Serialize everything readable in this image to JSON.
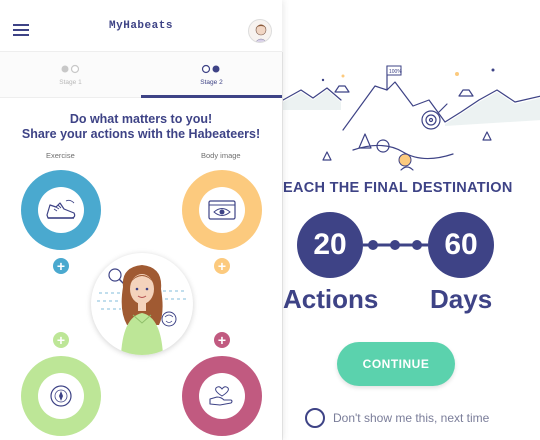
{
  "left_screen": {
    "header": {
      "app_title": "MyHabeats",
      "menu_icon": "hamburger-menu-icon",
      "avatar_icon": "user-avatar-icon"
    },
    "stages": [
      {
        "label": "Stage 1",
        "active": false
      },
      {
        "label": "Stage 2",
        "active": true
      }
    ],
    "headline_line1": "Do what matters to you!",
    "headline_line2": "Share your actions with the Habeateers!",
    "categories": {
      "exercise": {
        "label": "Exercise",
        "icon": "sneaker-icon",
        "color": "#4aa9cf"
      },
      "body_image": {
        "label": "Body image",
        "icon": "eye-screen-icon",
        "color": "#fcca7e"
      },
      "bottom_left": {
        "icon": "compass-icon",
        "color": "#bde697"
      },
      "bottom_right": {
        "icon": "hand-heart-icon",
        "color": "#c15a80"
      }
    },
    "plus_symbol": "+",
    "accent_color": "#3e4386"
  },
  "right_screen": {
    "title": "EACH THE FINAL DESTINATION",
    "actions_count": "20",
    "days_count": "60",
    "actions_label": "Actions",
    "days_label": "Days",
    "continue_label": "CONTINUE",
    "dont_show_label": "Don't show me this, next time",
    "illustration_icon": "mountain-summit-flag-icon",
    "flag_text": "100%",
    "button_color": "#5bd2ad"
  }
}
